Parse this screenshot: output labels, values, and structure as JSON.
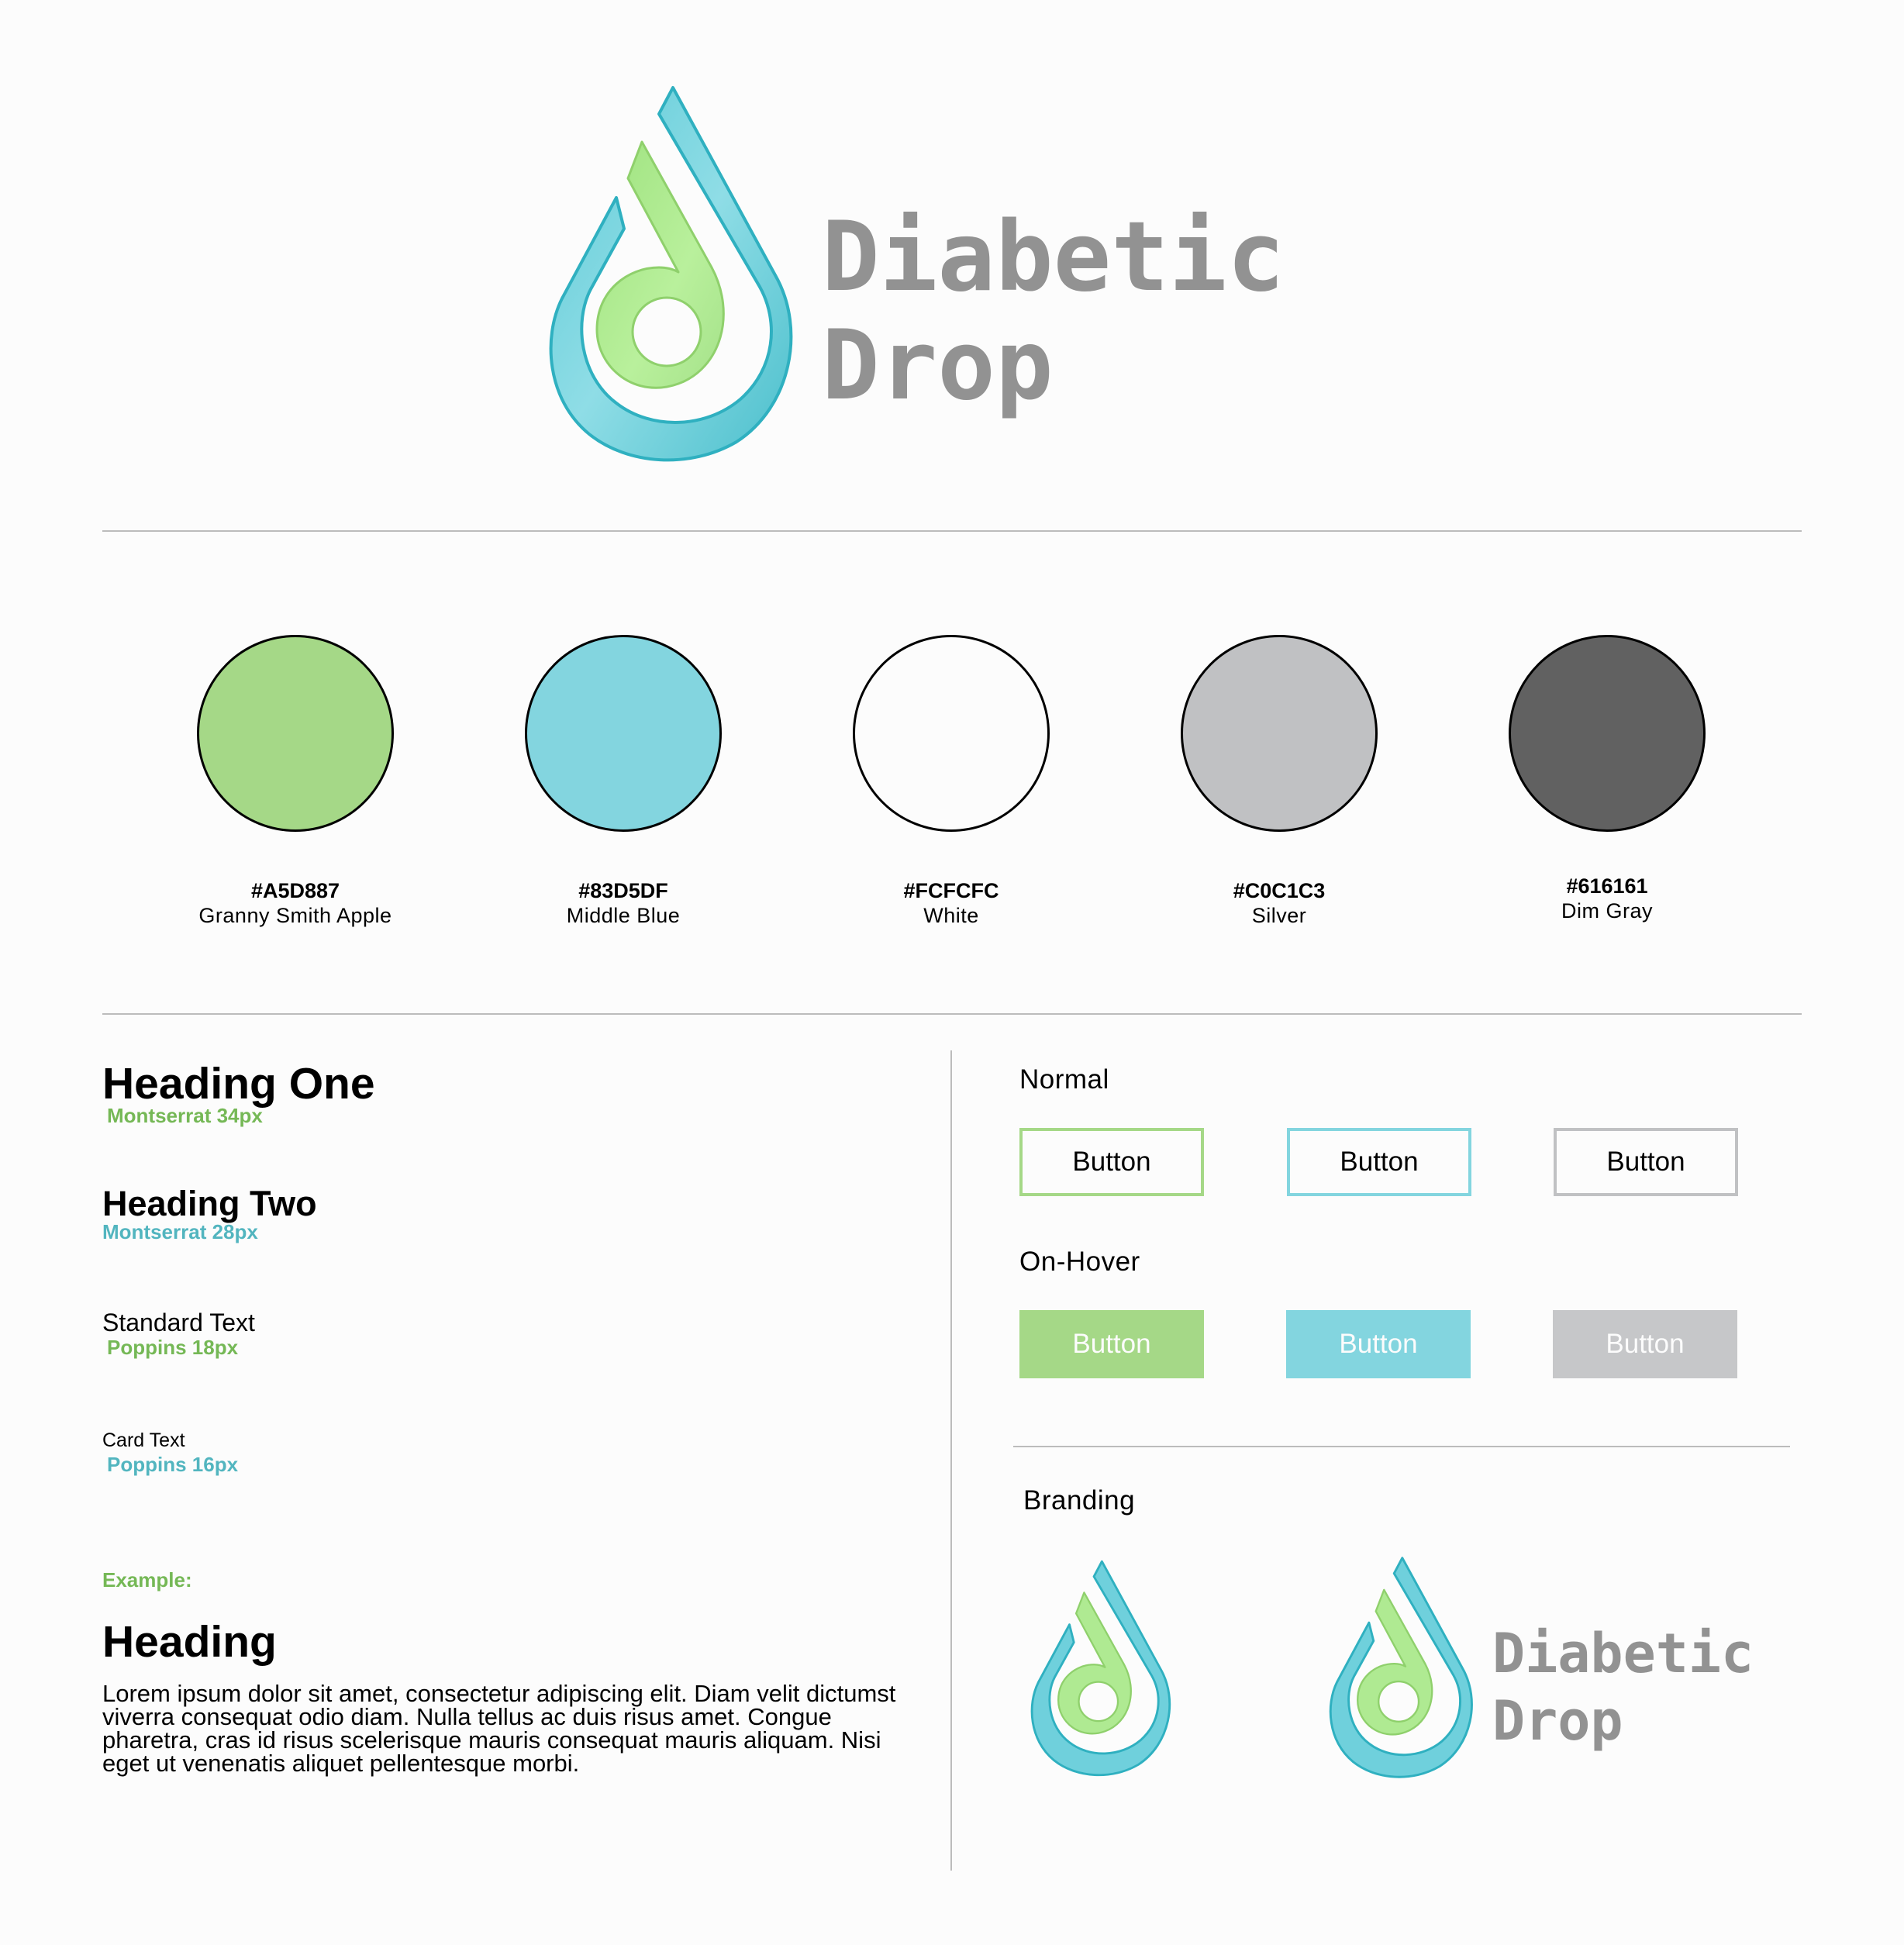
{
  "logo": {
    "line1": "Diabetic",
    "line2": "Drop"
  },
  "palette": [
    {
      "hex": "#A5D887",
      "name": "Granny Smith Apple",
      "color": "#a5d887"
    },
    {
      "hex": "#83D5DF",
      "name": "Middle Blue",
      "color": "#83d5df"
    },
    {
      "hex": "#FCFCFC",
      "name": "White",
      "color": "#fcfcfc"
    },
    {
      "hex": "#C0C1C3",
      "name": "Silver",
      "color": "#c0c1c3"
    },
    {
      "hex": "#616161",
      "name": "Dim Gray",
      "color": "#616161"
    }
  ],
  "typography": {
    "heading_one": {
      "label": "Heading One",
      "meta": "Montserrat  34px"
    },
    "heading_two": {
      "label": "Heading Two",
      "meta": "Montserrat  28px"
    },
    "standard_text": {
      "label": "Standard Text",
      "meta": "Poppins  18px"
    },
    "card_text": {
      "label": "Card Text",
      "meta": "Poppins  16px"
    },
    "example_label": "Example:",
    "example_heading": "Heading",
    "example_body": "Lorem ipsum dolor sit amet, consectetur adipiscing elit. Diam velit dictumst viverra consequat odio diam. Nulla tellus ac duis risus amet. Congue pharetra, cras id risus scelerisque mauris consequat mauris aliquam. Nisi eget ut venenatis aliquet pellentesque morbi."
  },
  "buttons": {
    "normal_label": "Normal",
    "hover_label": "On-Hover",
    "button_text": "Button"
  },
  "branding": {
    "label": "Branding",
    "line1": "Diabetic",
    "line2": "Drop"
  }
}
